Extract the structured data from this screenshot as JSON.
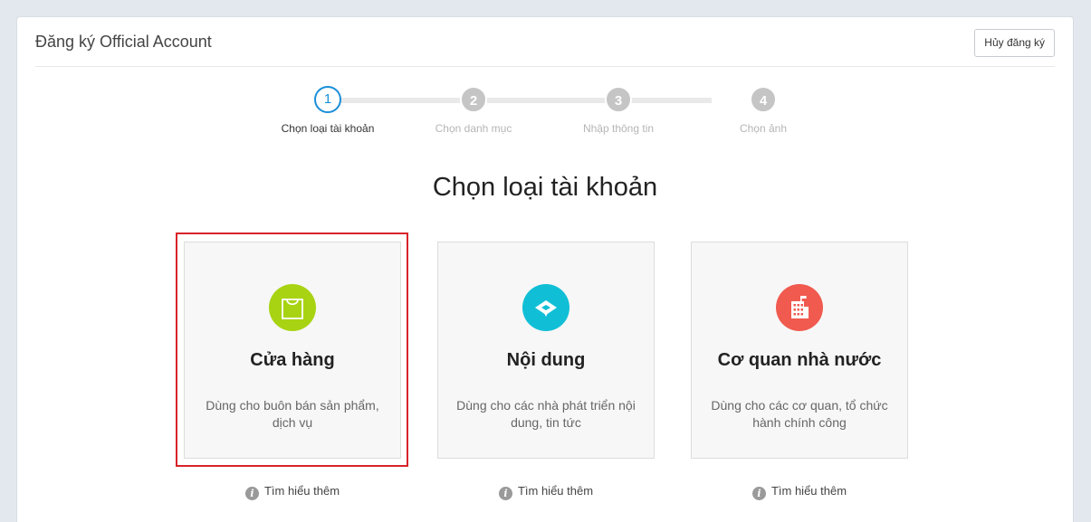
{
  "header": {
    "title": "Đăng ký Official Account",
    "cancel_label": "Hủy đăng ký"
  },
  "stepper": {
    "steps": [
      {
        "number": "1",
        "label": "Chọn loại tài khoản",
        "state": "active"
      },
      {
        "number": "2",
        "label": "Chọn danh mục",
        "state": "inactive"
      },
      {
        "number": "3",
        "label": "Nhập thông tin",
        "state": "inactive"
      },
      {
        "number": "4",
        "label": "Chọn ảnh",
        "state": "inactive"
      }
    ]
  },
  "main": {
    "heading": "Chọn loại tài khoản",
    "cards": [
      {
        "title": "Cửa hàng",
        "description": "Dùng cho buôn bán sản phẩm, dịch vụ",
        "icon": "shopping-bag-icon",
        "icon_color": "#a8d313",
        "selected": true,
        "learn_more": "Tìm hiểu thêm"
      },
      {
        "title": "Nội dung",
        "description": "Dùng cho các nhà phát triển nội dung, tin tức",
        "icon": "content-icon",
        "icon_color": "#10bfd6",
        "selected": false,
        "learn_more": "Tìm hiểu thêm"
      },
      {
        "title": "Cơ quan nhà nước",
        "description": "Dùng cho các cơ quan, tổ chức hành chính công",
        "icon": "building-icon",
        "icon_color": "#f05a4f",
        "selected": false,
        "learn_more": "Tìm hiểu thêm"
      }
    ]
  },
  "colors": {
    "active_step": "#1a8fd8",
    "inactive_step": "#c5c5c5",
    "selection_border": "#d8232a"
  }
}
